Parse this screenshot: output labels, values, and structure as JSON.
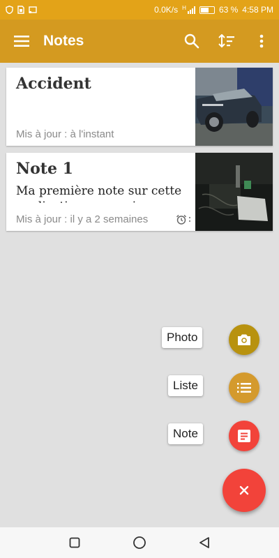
{
  "status_bar": {
    "network_speed": "0.0K/s",
    "network_type": "H",
    "battery": "63 %",
    "battery_level": 0.63,
    "time": "4:58 PM"
  },
  "app_bar": {
    "title": "Notes",
    "menu_icon": "hamburger-icon",
    "actions": [
      "search-icon",
      "sort-icon",
      "overflow-icon"
    ]
  },
  "notes": [
    {
      "title": "Accident",
      "body": "",
      "updated": "Mis à jour : à l'instant",
      "has_alarm": false,
      "thumbnail": "car-photo"
    },
    {
      "title": "Note 1",
      "body": "Ma première note sur cette application pour voir",
      "updated": "Mis à jour : il y a 2 semaines",
      "has_alarm": true,
      "thumbnail": "desk-photo"
    }
  ],
  "fab_menu": {
    "photo_label": "Photo",
    "list_label": "Liste",
    "note_label": "Note",
    "close_icon": "close-icon",
    "colors": {
      "photo": "#b8920f",
      "list": "#d49a2d",
      "note": "#f2433a",
      "main": "#f2433a"
    }
  },
  "theme": {
    "accent": "#d49a20",
    "status_bar": "#e3a318"
  },
  "nav_bar": {
    "buttons": [
      "recents-icon",
      "home-icon",
      "back-icon"
    ]
  }
}
